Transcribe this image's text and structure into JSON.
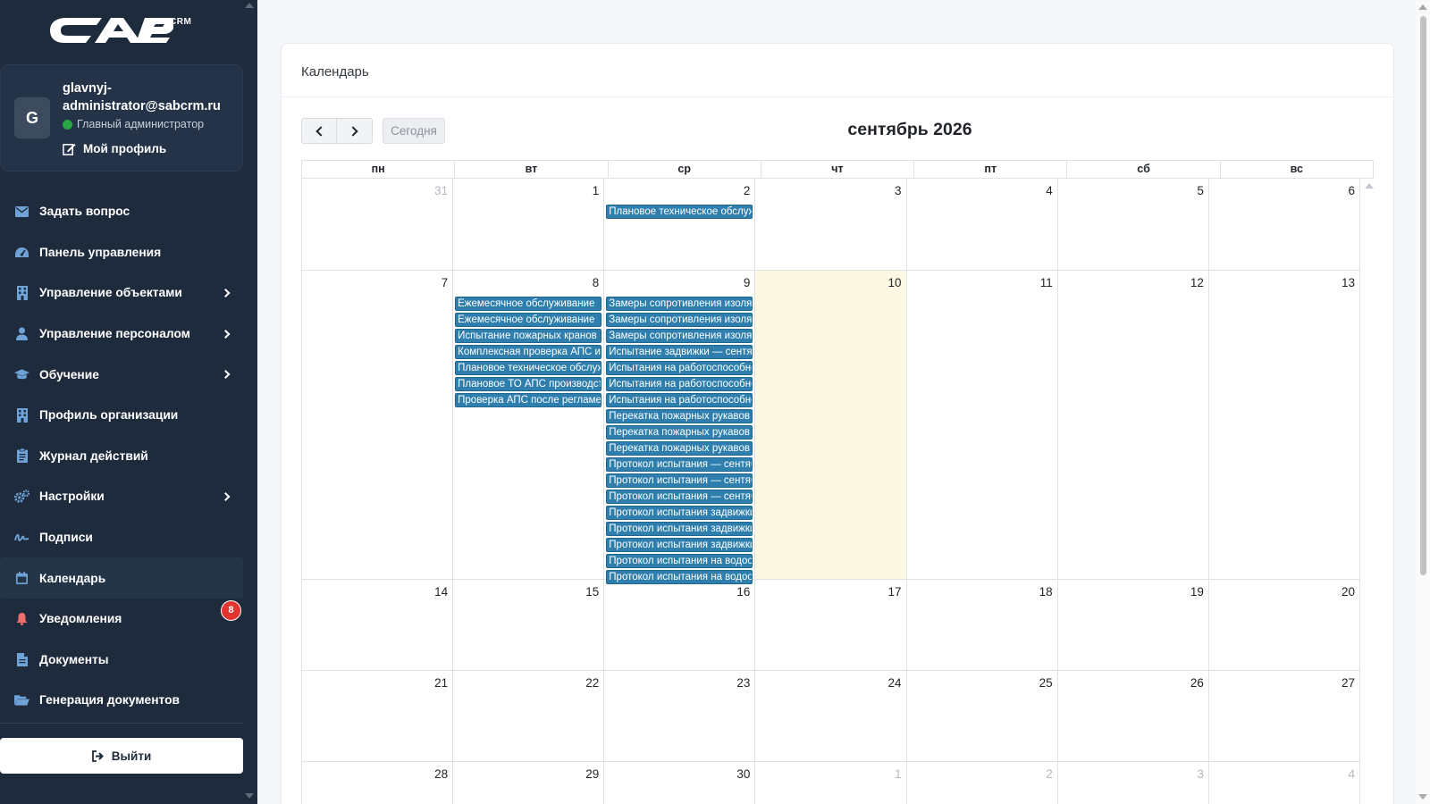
{
  "brand": {
    "logo_text": "CAB",
    "logo_suffix": "CRM"
  },
  "user": {
    "avatar_letter": "G",
    "name": "glavnyj-administrator@sabcrm.ru",
    "role": "Главный администратор",
    "profile_label": "Мой профиль"
  },
  "nav": {
    "items": [
      {
        "label": "Задать вопрос",
        "icon": "envelope-icon"
      },
      {
        "label": "Панель управления",
        "icon": "tachometer-icon"
      },
      {
        "label": "Управление объектами",
        "icon": "building-icon",
        "submenu": true
      },
      {
        "label": "Управление персоналом",
        "icon": "user-icon",
        "submenu": true
      },
      {
        "label": "Обучение",
        "icon": "graduation-cap-icon",
        "submenu": true
      },
      {
        "label": "Профиль организации",
        "icon": "building-icon"
      },
      {
        "label": "Журнал действий",
        "icon": "clipboard-icon"
      },
      {
        "label": "Настройки",
        "icon": "gears-icon",
        "submenu": true
      },
      {
        "label": "Подписи",
        "icon": "signature-icon"
      },
      {
        "label": "Календарь",
        "icon": "calendar-icon",
        "active": true
      },
      {
        "label": "Уведомления",
        "icon": "bell-icon",
        "badge": "8"
      },
      {
        "label": "Документы",
        "icon": "file-icon"
      },
      {
        "label": "Генерация документов",
        "icon": "folder-open-icon"
      }
    ],
    "logout_label": "Выйти"
  },
  "page": {
    "title": "Календарь"
  },
  "calendar": {
    "today_label": "Сегодня",
    "month_title": "сентябрь 2026",
    "weekdays": [
      "пн",
      "вт",
      "ср",
      "чт",
      "пт",
      "сб",
      "вс"
    ],
    "weeks": [
      [
        {
          "day": "31",
          "other": true,
          "events": []
        },
        {
          "day": "1",
          "events": []
        },
        {
          "day": "2",
          "events": [
            "Плановое техническое обслуживание"
          ]
        },
        {
          "day": "3",
          "events": []
        },
        {
          "day": "4",
          "events": []
        },
        {
          "day": "5",
          "events": []
        },
        {
          "day": "6",
          "events": []
        }
      ],
      [
        {
          "day": "7",
          "events": []
        },
        {
          "day": "8",
          "events": [
            "Ежемесячное обслуживание",
            "Ежемесячное обслуживание",
            "Испытание пожарных кранов",
            "Комплексная проверка АПС и",
            "Плановое техническое обслуж",
            "Плановое ТО АПС производст",
            "Проверка АПС после регламен"
          ]
        },
        {
          "day": "9",
          "events": [
            "Замеры сопротивления изоляц",
            "Замеры сопротивления изоляц",
            "Замеры сопротивления изоляц",
            "Испытание задвижки — сентяб",
            "Испытания на работоспособно",
            "Испытания на работоспособно",
            "Испытания на работоспособно",
            "Перекатка пожарных рукавов",
            "Перекатка пожарных рукавов",
            "Перекатка пожарных рукавов",
            "Протокол испытания — сентяб",
            "Протокол испытания — сентяб",
            "Протокол испытания — сентяб",
            "Протокол испытания задвижки",
            "Протокол испытания задвижки",
            "Протокол испытания задвижки",
            "Протокол испытания на водоот",
            "Протокол испытания на водоот"
          ]
        },
        {
          "day": "10",
          "today": true,
          "events": []
        },
        {
          "day": "11",
          "events": []
        },
        {
          "day": "12",
          "events": []
        },
        {
          "day": "13",
          "events": []
        }
      ],
      [
        {
          "day": "14",
          "events": []
        },
        {
          "day": "15",
          "events": []
        },
        {
          "day": "16",
          "events": []
        },
        {
          "day": "17",
          "events": []
        },
        {
          "day": "18",
          "events": []
        },
        {
          "day": "19",
          "events": []
        },
        {
          "day": "20",
          "events": []
        }
      ],
      [
        {
          "day": "21",
          "events": []
        },
        {
          "day": "22",
          "events": []
        },
        {
          "day": "23",
          "events": []
        },
        {
          "day": "24",
          "events": []
        },
        {
          "day": "25",
          "events": []
        },
        {
          "day": "26",
          "events": []
        },
        {
          "day": "27",
          "events": []
        }
      ],
      [
        {
          "day": "28",
          "events": []
        },
        {
          "day": "29",
          "events": []
        },
        {
          "day": "30",
          "events": []
        },
        {
          "day": "1",
          "other": true,
          "events": []
        },
        {
          "day": "2",
          "other": true,
          "events": []
        },
        {
          "day": "3",
          "other": true,
          "events": []
        },
        {
          "day": "4",
          "other": true,
          "events": []
        }
      ]
    ]
  },
  "colors": {
    "sidebar_bg": "#1e2b3c",
    "event_bg": "#2f7fae",
    "today_bg": "#fcf8e3",
    "badge_bg": "#e3342f",
    "status_online": "#28a745"
  }
}
